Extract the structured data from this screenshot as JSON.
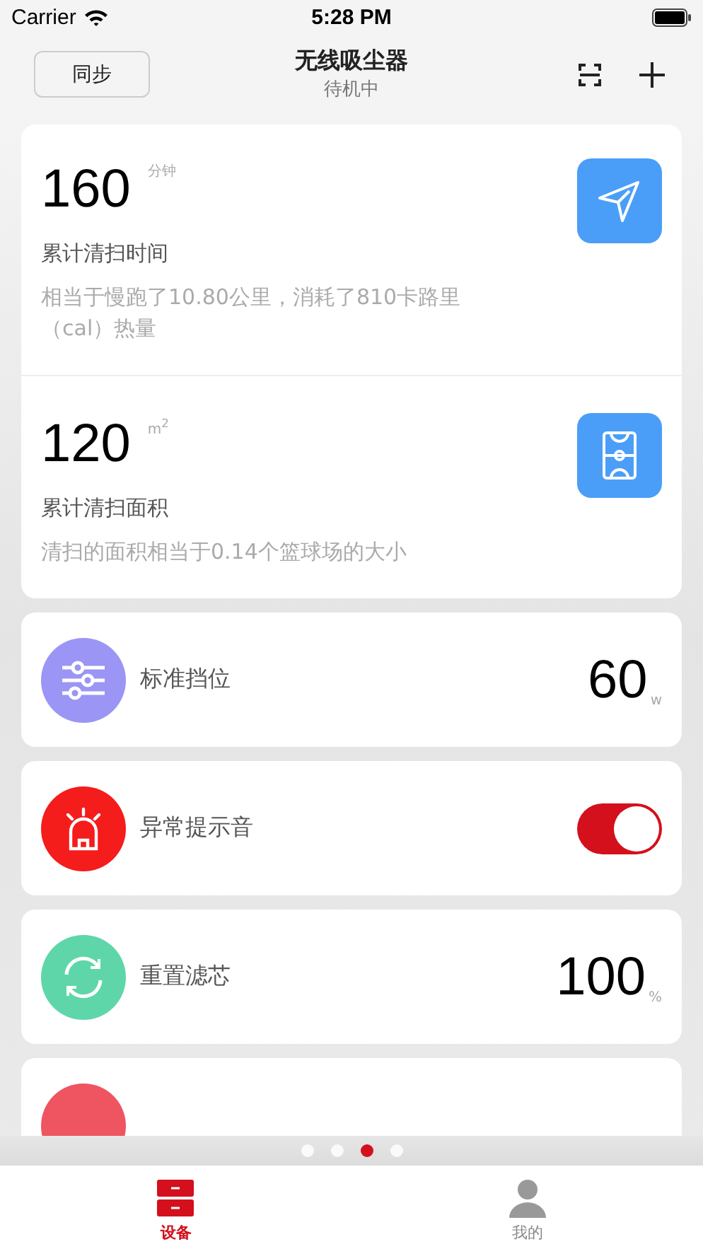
{
  "status_bar": {
    "carrier": "Carrier",
    "time": "5:28 PM"
  },
  "nav": {
    "sync_button": "同步",
    "title": "无线吸尘器",
    "subtitle": "待机中"
  },
  "stats": [
    {
      "kind": "time",
      "value": "160",
      "unit": "分钟",
      "label": "累计清扫时间",
      "description": "相当于慢跑了10.80公里，消耗了810卡路里（cal）热量"
    },
    {
      "kind": "area",
      "value": "120",
      "unit": "m$^{2}$",
      "label": "累计清扫面积",
      "description": "清扫的面积相当于0.14个篮球场的大小"
    }
  ],
  "rows": [
    {
      "kind": "value",
      "color": "#9b95f5",
      "label": "标准挡位",
      "value": "60",
      "unit": "w"
    },
    {
      "kind": "toggle",
      "color": "#f51c1c",
      "label": "异常提示音",
      "on": true
    },
    {
      "kind": "value",
      "color": "#5ed6aa",
      "label": "重置滤芯",
      "value": "100",
      "unit": "%"
    },
    {
      "kind": "partial",
      "color": "#ee5560"
    }
  ],
  "page_dots": [
    {
      "selected": false
    },
    {
      "selected": false
    },
    {
      "selected": true
    },
    {
      "selected": false
    }
  ],
  "tabs": [
    {
      "label": "设备",
      "selected": true
    },
    {
      "label": "我的",
      "selected": false
    }
  ]
}
